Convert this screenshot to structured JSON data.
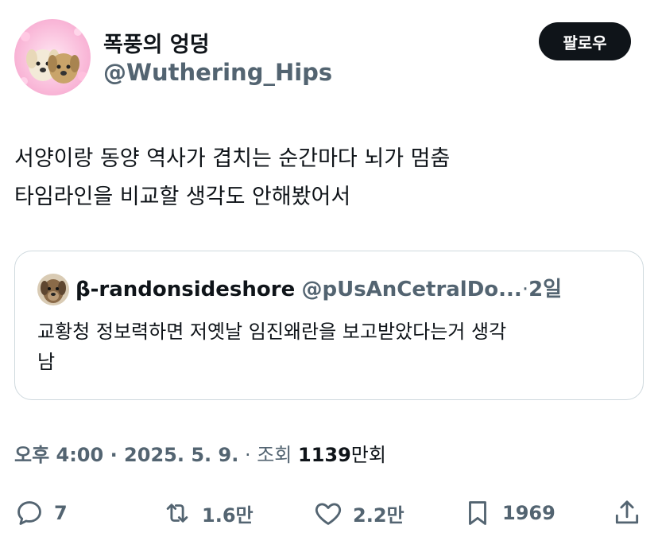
{
  "author": {
    "display_name": "폭풍의 엉덩",
    "handle": "@Wuthering_Hips",
    "avatar_icon": "dog-avatar-icon"
  },
  "follow_label": "팔로우",
  "tweet": {
    "lines": [
      "서양이랑 동양 역사가 겹치는 순간마다 뇌가 멈춤",
      "타임라인을 비교할 생각도 안해봤어서"
    ]
  },
  "quote": {
    "display_name": "β-randonsideshore",
    "handle": "@pUsAnCetralDo...",
    "separator": "·",
    "time": "2일",
    "lines": [
      "교황청 정보력하면 저옛날 임진왜란을 보고받았다는거 생각",
      "남"
    ]
  },
  "meta": {
    "time": "오후 4:00",
    "sep1": " · ",
    "date": "2025. 5. 9.",
    "sep2": " · ",
    "views_label": "조회 ",
    "views_count": "1139",
    "views_unit": "만회"
  },
  "actions": {
    "replies": "7",
    "retweets": "1.6만",
    "likes": "2.2만",
    "bookmarks": "1969"
  },
  "colors": {
    "text": "#0f1419",
    "secondary": "#536471",
    "border": "#cfd9de",
    "follow_bg": "#0f1419"
  }
}
